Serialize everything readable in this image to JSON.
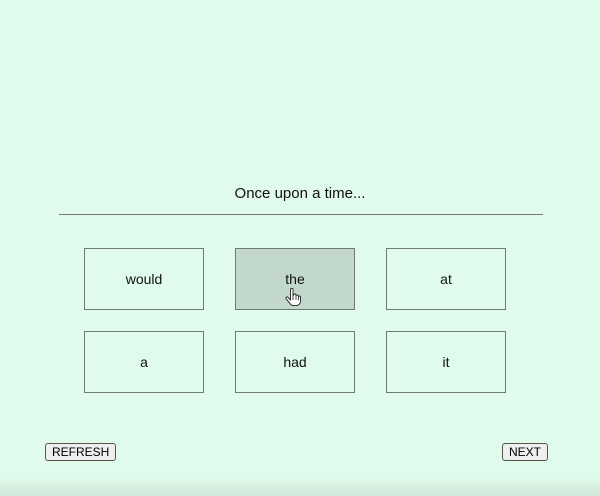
{
  "story": {
    "prompt": "Once upon a time..."
  },
  "word_choices": [
    {
      "label": "would",
      "selected": false
    },
    {
      "label": "the",
      "selected": true
    },
    {
      "label": "at",
      "selected": false
    },
    {
      "label": "a",
      "selected": false
    },
    {
      "label": "had",
      "selected": false
    },
    {
      "label": "it",
      "selected": false
    }
  ],
  "controls": {
    "refresh_label": "REFRESH",
    "next_label": "NEXT"
  },
  "colors": {
    "background": "#e0fbeb",
    "selected_card": "#c2d8ca",
    "card_border": "#6f7a74"
  },
  "icons": {
    "cursor": "hand-pointer-icon"
  }
}
